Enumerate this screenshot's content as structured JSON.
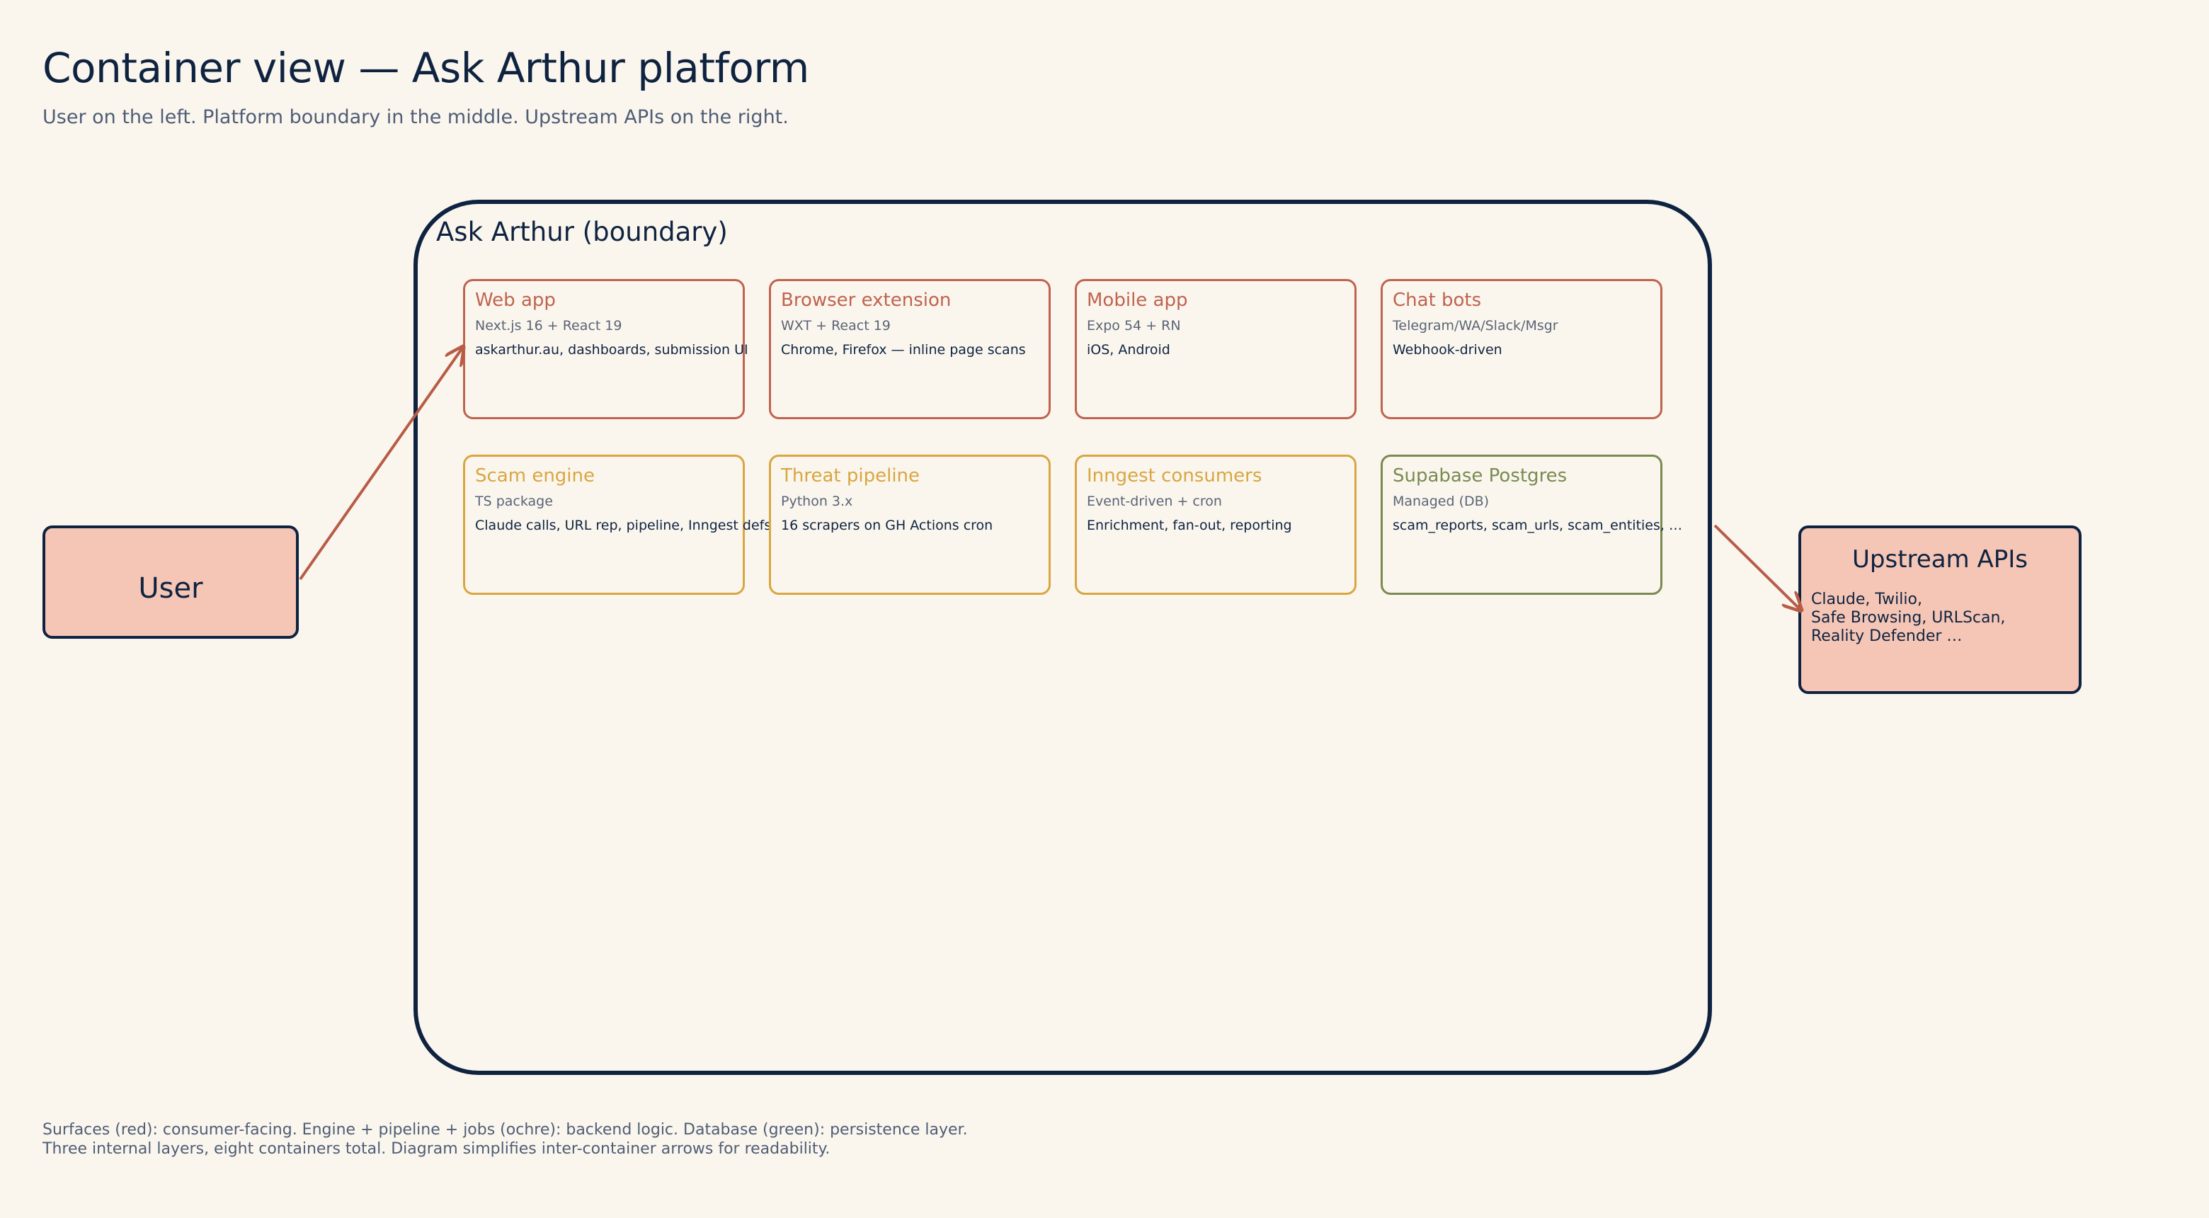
{
  "header": {
    "title": "Container view — Ask Arthur platform",
    "subtitle": "User on the left. Platform boundary in the middle. Upstream APIs on the right."
  },
  "boundary": {
    "label": "Ask Arthur (boundary)"
  },
  "actors": {
    "user": {
      "label": "User"
    },
    "upstream": {
      "label": "Upstream APIs",
      "lines": [
        "Claude, Twilio,",
        "Safe Browsing, URLScan,",
        "Reality Defender …"
      ]
    }
  },
  "containers": [
    {
      "name": "Web app",
      "tech": "Next.js 16 + React 19",
      "desc": "askarthur.au, dashboards, submission UI",
      "category": "surface"
    },
    {
      "name": "Browser extension",
      "tech": "WXT + React 19",
      "desc": "Chrome, Firefox — inline page scans",
      "category": "surface"
    },
    {
      "name": "Mobile app",
      "tech": "Expo 54 + RN",
      "desc": "iOS, Android",
      "category": "surface"
    },
    {
      "name": "Chat bots",
      "tech": "Telegram/WA/Slack/Msgr",
      "desc": "Webhook-driven",
      "category": "surface"
    },
    {
      "name": "Scam engine",
      "tech": "TS package",
      "desc": "Claude calls, URL rep, pipeline, Inngest defs",
      "category": "backend"
    },
    {
      "name": "Threat pipeline",
      "tech": "Python 3.x",
      "desc": "16 scrapers on GH Actions cron",
      "category": "backend"
    },
    {
      "name": "Inngest consumers",
      "tech": "Event-driven + cron",
      "desc": "Enrichment, fan-out, reporting",
      "category": "backend"
    },
    {
      "name": "Supabase Postgres",
      "tech": "Managed (DB)",
      "desc": "scam_reports, scam_urls, scam_entities, …",
      "category": "database"
    }
  ],
  "colors": {
    "ink": "#0f2340",
    "surface": "#c0634e",
    "backend": "#d9a640",
    "database": "#7a8a50",
    "actor_fill": "#f5c6b6",
    "background": "#faf6ee",
    "arrow": "#b85c47"
  },
  "footnote": {
    "line1": "Surfaces (red): consumer-facing. Engine + pipeline + jobs (ochre): backend logic. Database (green): persistence layer.",
    "line2": "Three internal layers, eight containers total. Diagram simplifies inter-container arrows for readability."
  }
}
